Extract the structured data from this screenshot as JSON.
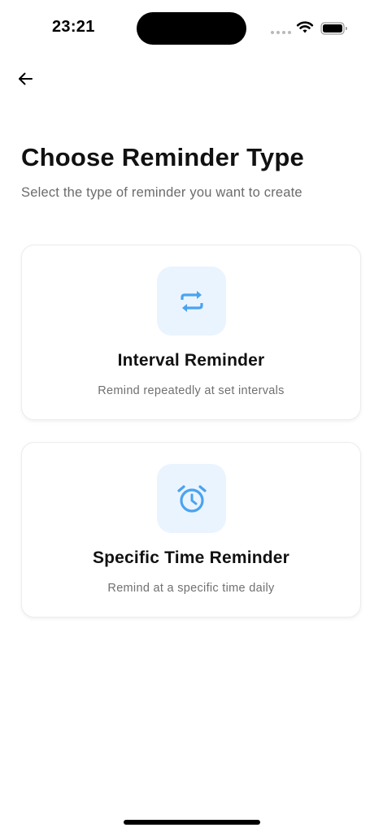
{
  "status_bar": {
    "time": "23:21"
  },
  "header": {
    "back_icon": "arrow-left-icon",
    "title": "Choose Reminder Type",
    "subtitle": "Select the type of reminder you want to create"
  },
  "options": [
    {
      "icon": "repeat-icon",
      "title": "Interval Reminder",
      "description": "Remind repeatedly at set intervals"
    },
    {
      "icon": "alarm-clock-icon",
      "title": "Specific Time Reminder",
      "description": "Remind at a specific time daily"
    }
  ],
  "colors": {
    "accent": "#4aa3f0",
    "icon_tile_bg": "#eaf4fe"
  }
}
